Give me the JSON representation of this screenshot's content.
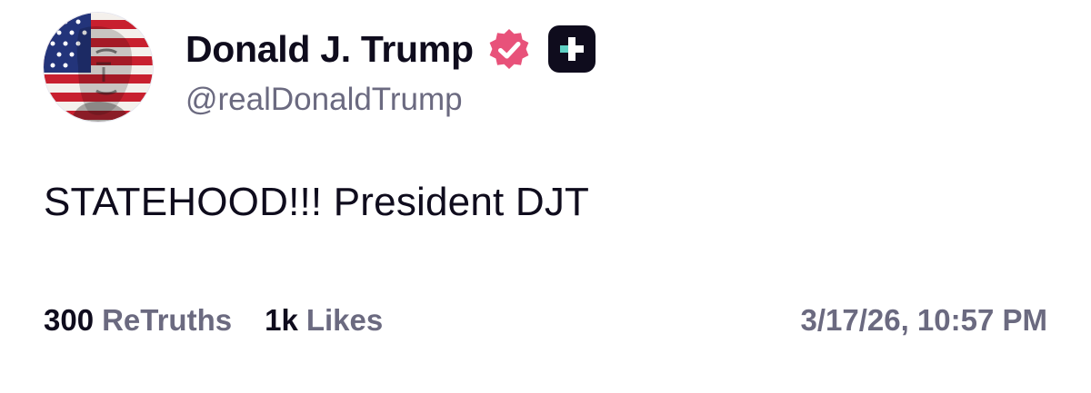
{
  "author": {
    "display_name": "Donald J. Trump",
    "handle": "@realDonaldTrump",
    "verified_icon": "verified-badge-icon",
    "plus_icon": "truth-plus-icon"
  },
  "post": {
    "text": "STATEHOOD!!! President DJT"
  },
  "stats": {
    "retruths_count": "300",
    "retruths_label": "ReTruths",
    "likes_count": "1k",
    "likes_label": "Likes"
  },
  "timestamp": "3/17/26, 10:57 PM",
  "colors": {
    "text_primary": "#0f0c1d",
    "text_secondary": "#6b6a80",
    "verified_pink": "#e8527a",
    "plus_badge_bg": "#0f0c1d",
    "plus_badge_accent": "#5fd0c4"
  }
}
